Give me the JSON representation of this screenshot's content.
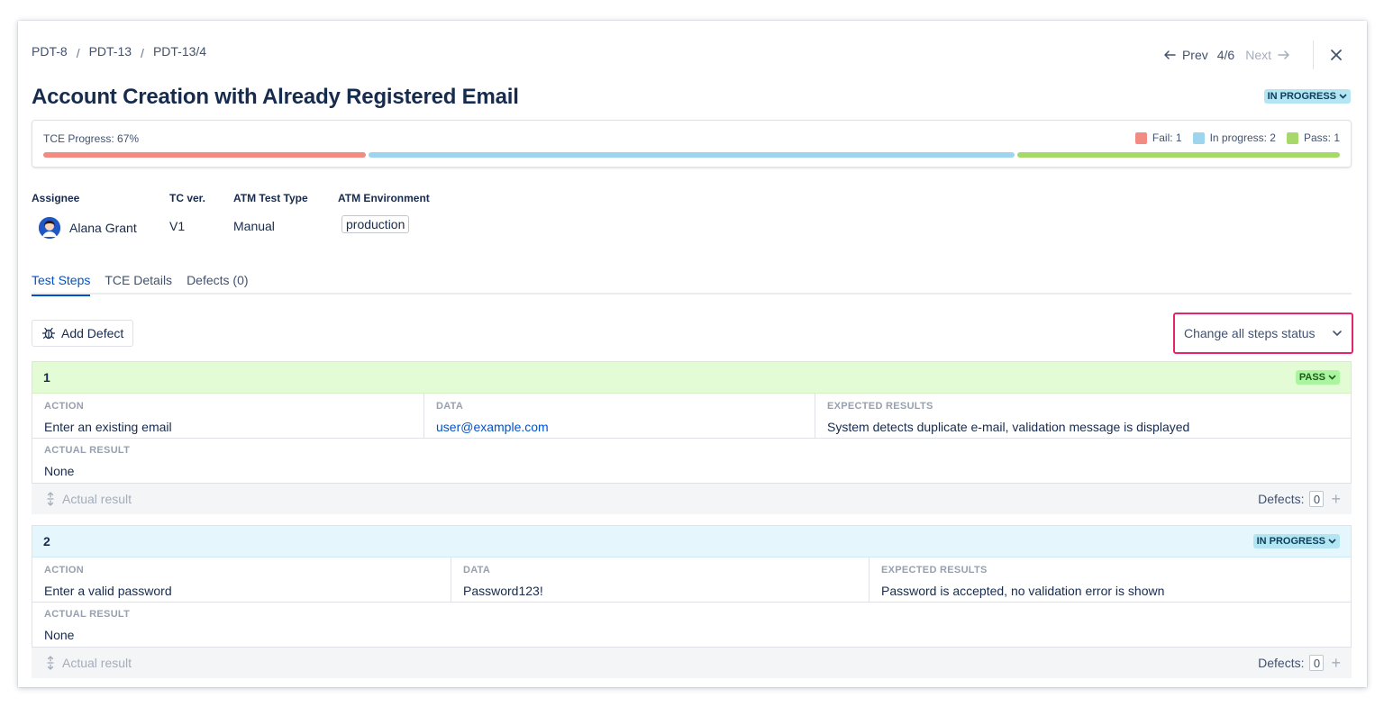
{
  "breadcrumb": [
    "PDT-8",
    "PDT-13",
    "PDT-13/4"
  ],
  "breadcrumb_separator": "/",
  "nav": {
    "prev": "Prev",
    "counter": "4/6",
    "next": "Next"
  },
  "title": "Account Creation with Already Registered Email",
  "status": "IN PROGRESS",
  "progress": {
    "label": "TCE Progress: 67%",
    "legend": [
      {
        "label": "Fail: 1",
        "color": "#f28b82"
      },
      {
        "label": "In progress: 2",
        "color": "#9dd6ec"
      },
      {
        "label": "Pass: 1",
        "color": "#a6d96a"
      }
    ],
    "segments": [
      {
        "status": "fail",
        "fraction": 0.25,
        "color": "#f28b82"
      },
      {
        "status": "in_progress",
        "fraction": 0.5,
        "color": "#9dd6ec"
      },
      {
        "status": "pass",
        "fraction": 0.25,
        "color": "#a6d96a"
      }
    ]
  },
  "meta": {
    "assignee_label": "Assignee",
    "assignee": "Alana Grant",
    "tc_ver_label": "TC ver.",
    "tc_ver": "V1",
    "test_type_label": "ATM Test Type",
    "test_type": "Manual",
    "env_label": "ATM Environment",
    "env": "production"
  },
  "tabs": [
    "Test Steps",
    "TCE Details",
    "Defects (0)"
  ],
  "active_tab": "Test Steps",
  "add_defect": "Add Defect",
  "change_all": "Change all steps status",
  "labels": {
    "action": "ACTION",
    "data": "DATA",
    "expected": "EXPECTED RESULTS",
    "actual": "ACTUAL RESULT",
    "actual_placeholder": "Actual result",
    "defects": "Defects:"
  },
  "steps": [
    {
      "number": "1",
      "status": "PASS",
      "action": "Enter an existing email",
      "data": "user@example.com",
      "expected": "System detects duplicate e-mail, validation message is displayed",
      "actual": "None",
      "defects": "0"
    },
    {
      "number": "2",
      "status": "IN PROGRESS",
      "action": "Enter a valid password",
      "data": "Password123!",
      "expected": "Password is accepted, no validation error is shown",
      "actual": "None",
      "defects": "0"
    }
  ]
}
